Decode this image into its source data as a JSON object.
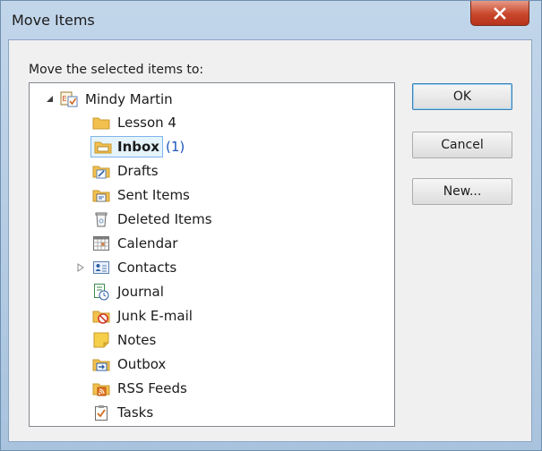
{
  "window": {
    "title": "Move Items"
  },
  "dialog": {
    "prompt": "Move the selected items to:"
  },
  "tree": {
    "root": {
      "label": "Mindy Martin",
      "expanded": true
    },
    "items": [
      {
        "label": "Lesson 4",
        "icon": "folder-icon"
      },
      {
        "label": "Inbox",
        "count": "(1)",
        "icon": "inbox-icon",
        "selected": true
      },
      {
        "label": "Drafts",
        "icon": "drafts-icon"
      },
      {
        "label": "Sent Items",
        "icon": "sent-items-icon"
      },
      {
        "label": "Deleted Items",
        "icon": "deleted-items-icon"
      },
      {
        "label": "Calendar",
        "icon": "calendar-icon"
      },
      {
        "label": "Contacts",
        "icon": "contacts-icon",
        "collapsed": true
      },
      {
        "label": "Journal",
        "icon": "journal-icon"
      },
      {
        "label": "Junk E-mail",
        "icon": "junk-email-icon"
      },
      {
        "label": "Notes",
        "icon": "notes-icon"
      },
      {
        "label": "Outbox",
        "icon": "outbox-icon"
      },
      {
        "label": "RSS Feeds",
        "icon": "rss-feeds-icon"
      },
      {
        "label": "Tasks",
        "icon": "tasks-icon"
      }
    ]
  },
  "buttons": {
    "ok": "OK",
    "cancel": "Cancel",
    "new": "New..."
  },
  "colors": {
    "selection_bg": "#e5f3fb",
    "selection_border": "#7eb4ea",
    "count_blue": "#1e57c0",
    "close_red": "#c8472b"
  }
}
